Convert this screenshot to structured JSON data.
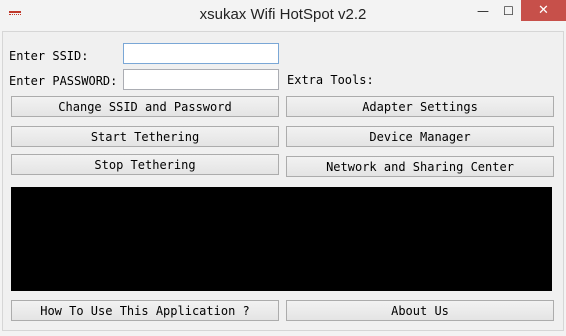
{
  "window": {
    "title": "xsukax Wifi HotSpot v2.2",
    "minimize_glyph": "—",
    "maximize_glyph": "☐",
    "close_glyph": "✕"
  },
  "form": {
    "ssid_label": "Enter SSID:",
    "ssid_value": "",
    "password_label": "Enter PASSWORD:",
    "password_value": "",
    "extra_tools_label": "Extra Tools:"
  },
  "buttons": {
    "change": "Change SSID and Password",
    "start": "Start Tethering",
    "stop": "Stop Tethering",
    "adapter": "Adapter Settings",
    "device": "Device Manager",
    "network": "Network and Sharing Center",
    "howto": "How To Use This Application ?",
    "about": "About Us"
  },
  "console": {
    "text": ""
  },
  "colors": {
    "close_button": "#c7504a",
    "console_background": "#000000",
    "focused_border": "#7aa7d6"
  }
}
